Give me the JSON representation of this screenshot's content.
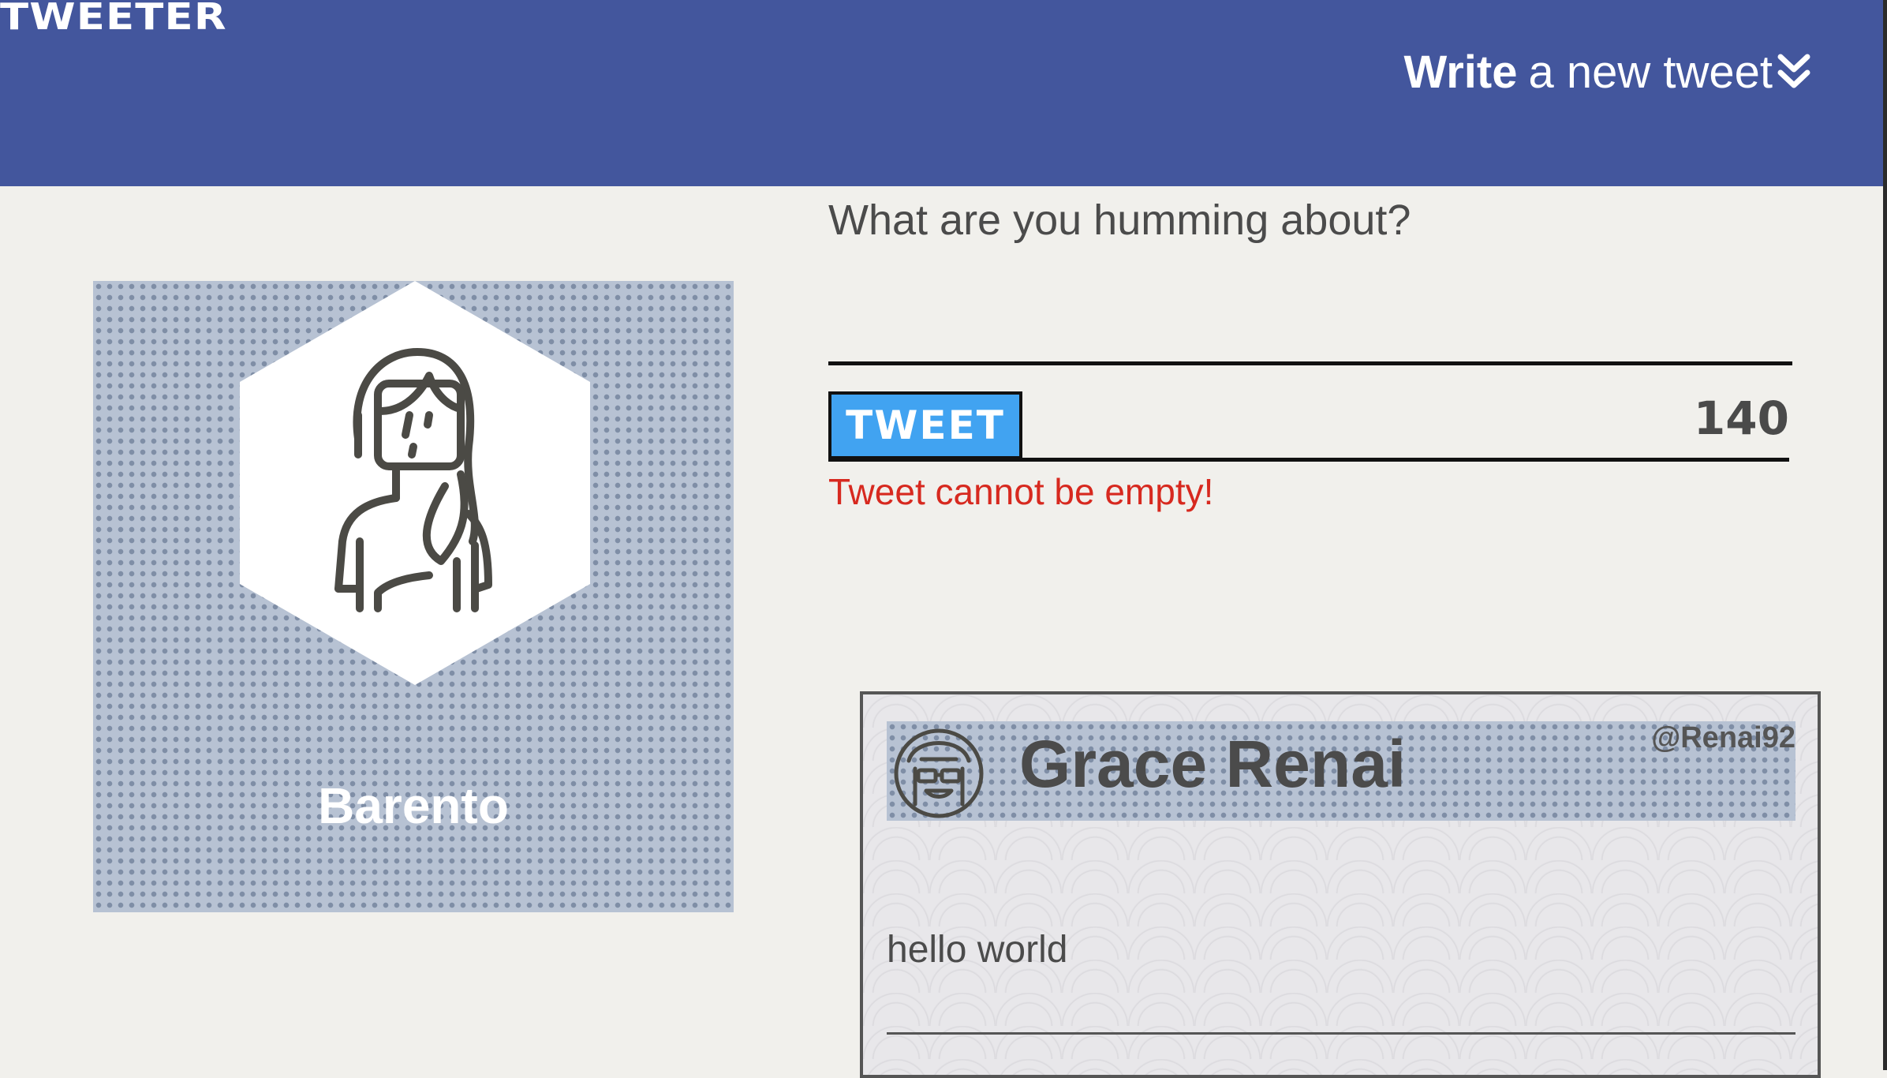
{
  "nav": {
    "brand": "TWEETER",
    "compose_strong": "Write",
    "compose_rest": "a new tweet"
  },
  "profile": {
    "name": "Barento"
  },
  "composer": {
    "prompt": "What are you humming about?",
    "input_value": "",
    "button_label": "TWEET",
    "counter": "140",
    "error": "Tweet cannot be empty!"
  },
  "tweets": [
    {
      "name": "Grace Renai",
      "handle": "@Renai92",
      "content": "hello world"
    }
  ],
  "colors": {
    "nav_bg": "#43569d",
    "page_bg": "#f1f0ec",
    "button_bg": "#41a3f1",
    "error": "#d7291f"
  }
}
